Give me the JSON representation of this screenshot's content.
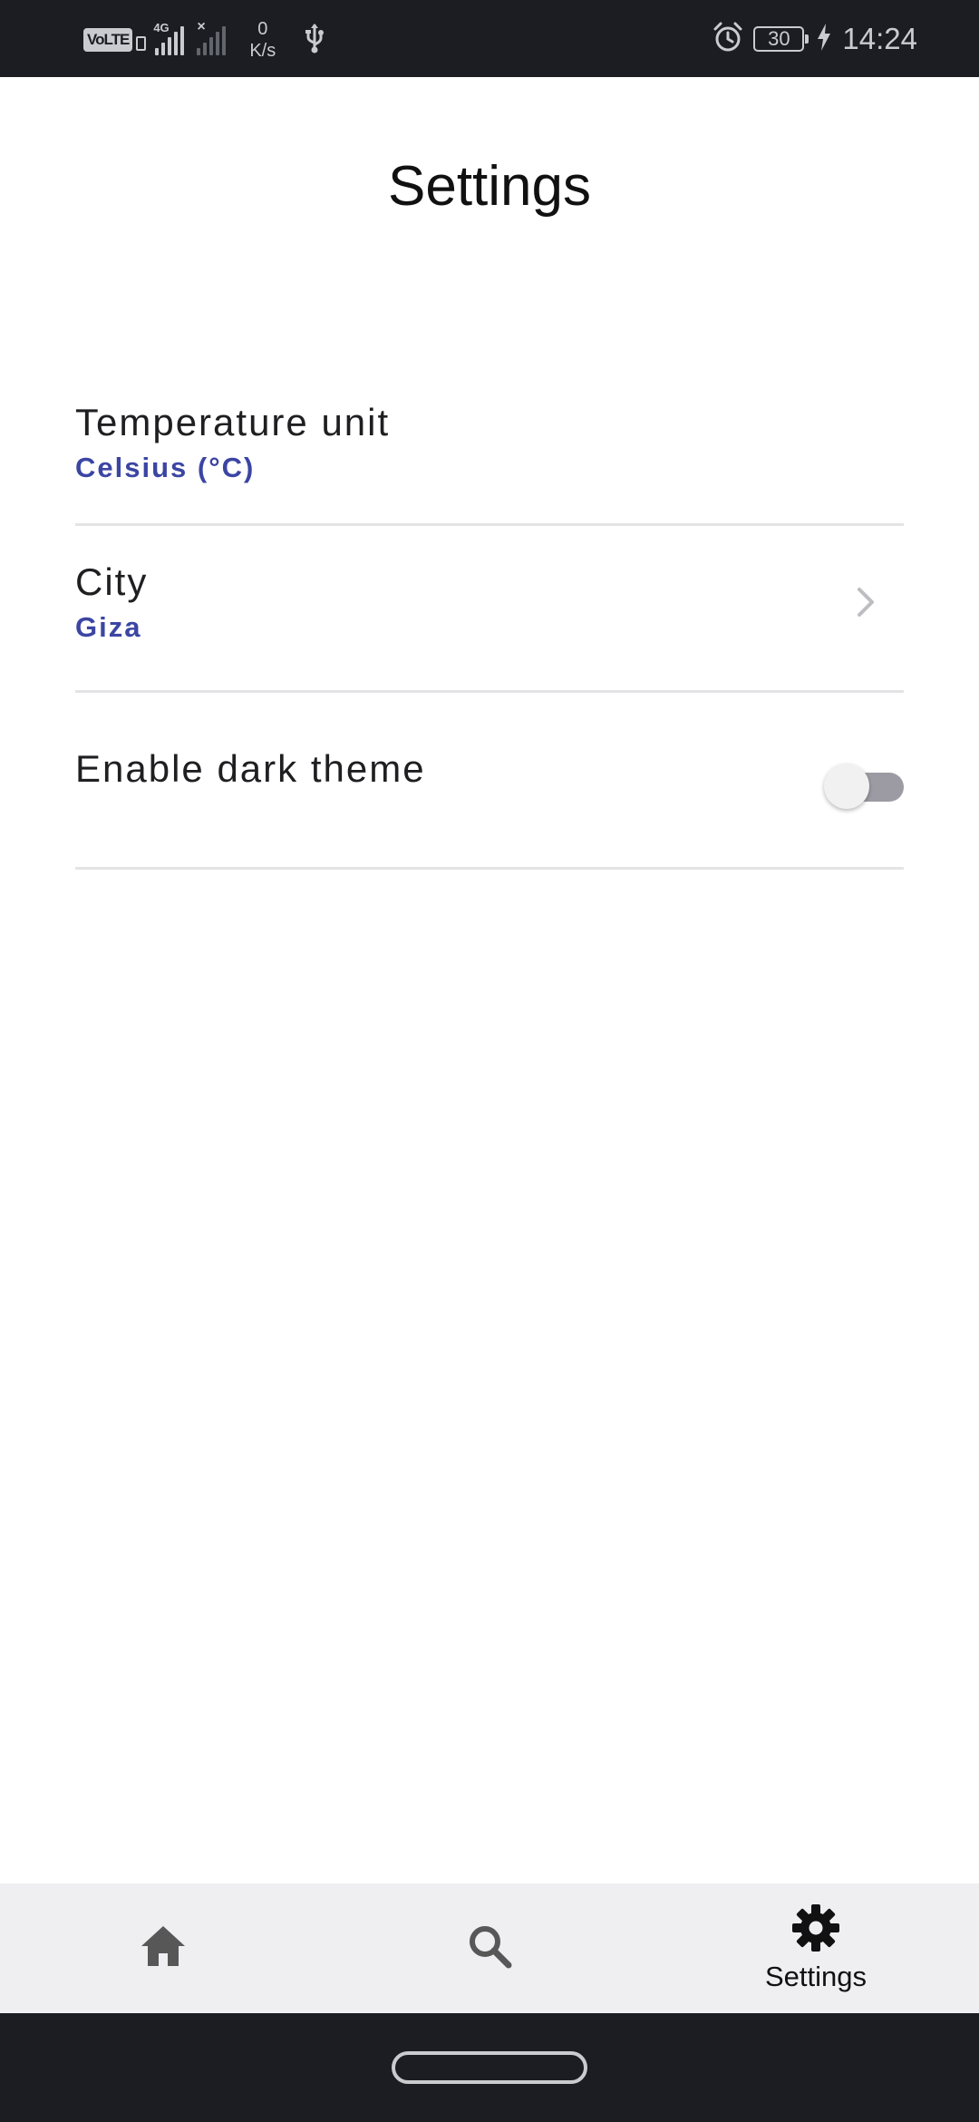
{
  "status_bar": {
    "volte": "VoLTE",
    "network": "4G",
    "speed_value": "0",
    "speed_unit": "K/s",
    "battery": "30",
    "time": "14:24"
  },
  "page": {
    "title": "Settings"
  },
  "settings": {
    "items": [
      {
        "title": "Temperature unit",
        "value": "Celsius (°C)"
      },
      {
        "title": "City",
        "value": "Giza"
      },
      {
        "title": "Enable dark theme",
        "toggle_on": false
      }
    ]
  },
  "bottom_nav": {
    "items": [
      {
        "icon": "home-icon",
        "label": ""
      },
      {
        "icon": "search-icon",
        "label": ""
      },
      {
        "icon": "gear-icon",
        "label": "Settings"
      }
    ],
    "active_index": 2
  },
  "colors": {
    "accent": "#3b45a3",
    "status_bar_bg": "#1b1d22",
    "nav_bg": "#efeff2",
    "divider": "#e4e4e6"
  }
}
